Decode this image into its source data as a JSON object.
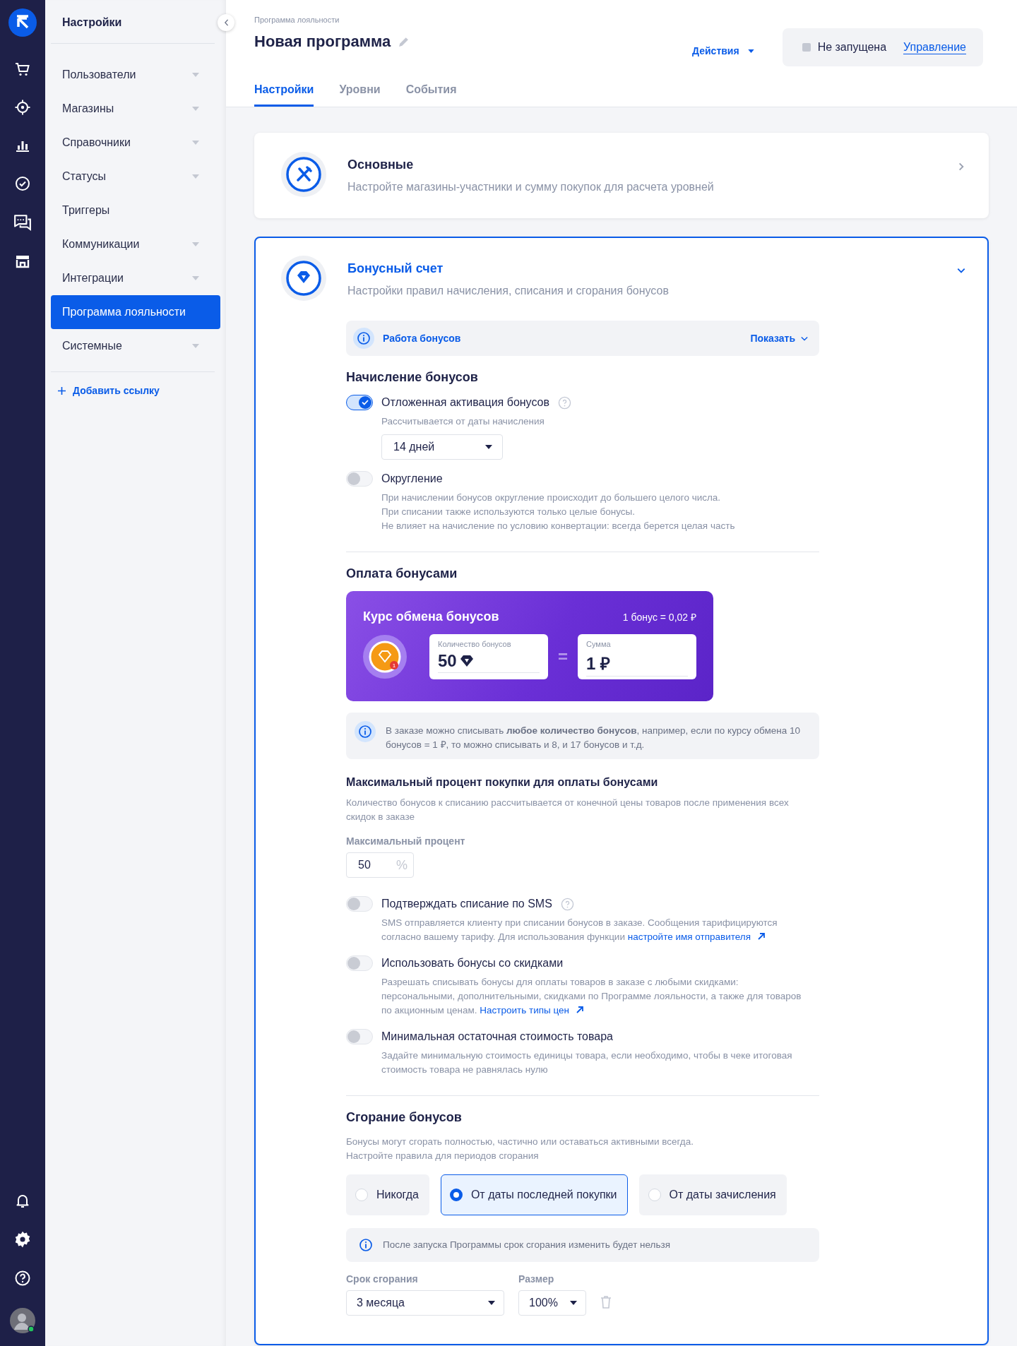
{
  "sidebar": {
    "title": "Настройки",
    "items": [
      {
        "label": "Пользователи",
        "expandable": true,
        "selected": false
      },
      {
        "label": "Магазины",
        "expandable": true,
        "selected": false
      },
      {
        "label": "Справочники",
        "expandable": true,
        "selected": false
      },
      {
        "label": "Статусы",
        "expandable": true,
        "selected": false
      },
      {
        "label": "Триггеры",
        "expandable": false,
        "selected": false
      },
      {
        "label": "Коммуникации",
        "expandable": true,
        "selected": false
      },
      {
        "label": "Интеграции",
        "expandable": true,
        "selected": false
      },
      {
        "label": "Программа лояльности",
        "expandable": false,
        "selected": true
      },
      {
        "label": "Системные",
        "expandable": true,
        "selected": false
      }
    ],
    "add_link": "Добавить ссылку"
  },
  "header": {
    "breadcrumb": "Программа лояльности",
    "title": "Новая программа",
    "actions": "Действия",
    "status": {
      "label": "Не запущена",
      "link": "Управление"
    },
    "tabs": [
      {
        "label": "Настройки",
        "selected": true
      },
      {
        "label": "Уровни",
        "selected": false
      },
      {
        "label": "События",
        "selected": false
      }
    ]
  },
  "basic_card": {
    "title": "Основные",
    "subtitle": "Настройте магазины-участники и сумму покупок для расчета уровней",
    "expanded": false
  },
  "bonus_card": {
    "title": "Бонусный счет",
    "subtitle": "Настройки правил начисления, списания и сгорания бонусов",
    "expanded": true,
    "info_bar": {
      "label": "Работа бонусов",
      "toggle": "Показать"
    },
    "accrual": {
      "heading": "Начисление бонусов",
      "options": [
        {
          "label": "Отложенная активация бонусов",
          "on": true,
          "help": true,
          "hint": [
            "Рассчитывается от даты начисления"
          ],
          "select": "14 дней"
        },
        {
          "label": "Округление",
          "on": false,
          "help": false,
          "hint": [
            "При начислении бонусов округление происходит до большего целого числа.",
            "При списании также используются только целые бонусы.",
            "Не влияет на начисление по условию конвертации: всегда берется целая часть"
          ]
        }
      ]
    },
    "payment": {
      "heading": "Оплата бонусами",
      "exchange": {
        "title": "Курс обмена бонусов",
        "rate": "1 бонус = 0,02 ₽",
        "badge": "1",
        "fields": [
          {
            "label": "Количество бонусов",
            "value": "50",
            "kind": "bonus"
          },
          {
            "label": "Сумма",
            "value": "1 ₽",
            "kind": "money"
          }
        ],
        "equals": "="
      },
      "note": "В заказе можно списывать **любое количество бонусов**, например, если по курсу обмена 10 бонусов = 1 ₽, то можно списывать и 8, и 17 бонусов и т.д.",
      "max_heading": "Максимальный процент покупки для оплаты бонусами",
      "max_desc": "Количество бонусов к списанию рассчитывается от конечной цены товаров после применения всех скидок в заказе",
      "max_label": "Максимальный процент",
      "max_value": "50",
      "max_unit": "%",
      "options": [
        {
          "label": "Подтверждать списание по SMS",
          "on": false,
          "help": true,
          "hint": [
            "SMS отправляется клиенту при списании бонусов в заказе. Сообщения тарифицируются согласно вашему тарифу. Для использования функции "
          ],
          "link": "настройте имя отправителя"
        },
        {
          "label": "Использовать бонусы со скидками",
          "on": false,
          "help": false,
          "hint": [
            "Разрешать списывать бонусы для оплаты товаров в заказе с любыми скидками: персональными, дополнительными, скидками по Программе лояльности, а также для товаров по акционным ценам. "
          ],
          "link": "Настроить типы цен"
        },
        {
          "label": "Минимальная остаточная стоимость товара",
          "on": false,
          "help": false,
          "hint": [
            "Задайте минимальную стоимость единицы товара, если необходимо, чтобы в чеке итоговая стоимость товара не равнялась нулю"
          ]
        }
      ]
    },
    "expiry": {
      "heading": "Сгорание бонусов",
      "desc": [
        "Бонусы могут сгорать полностью, частично или оставаться активными всегда.",
        "Настройте правила для периодов сгорания"
      ],
      "radios": [
        {
          "label": "Никогда",
          "selected": false
        },
        {
          "label": "От даты последней покупки",
          "selected": true
        },
        {
          "label": "От даты зачисления",
          "selected": false
        }
      ],
      "note": "После запуска Программы срок сгорания изменить будет нельзя",
      "fields": [
        {
          "label": "Срок сгорания",
          "value": "3 месяца"
        },
        {
          "label": "Размер",
          "value": "100%"
        }
      ]
    }
  }
}
